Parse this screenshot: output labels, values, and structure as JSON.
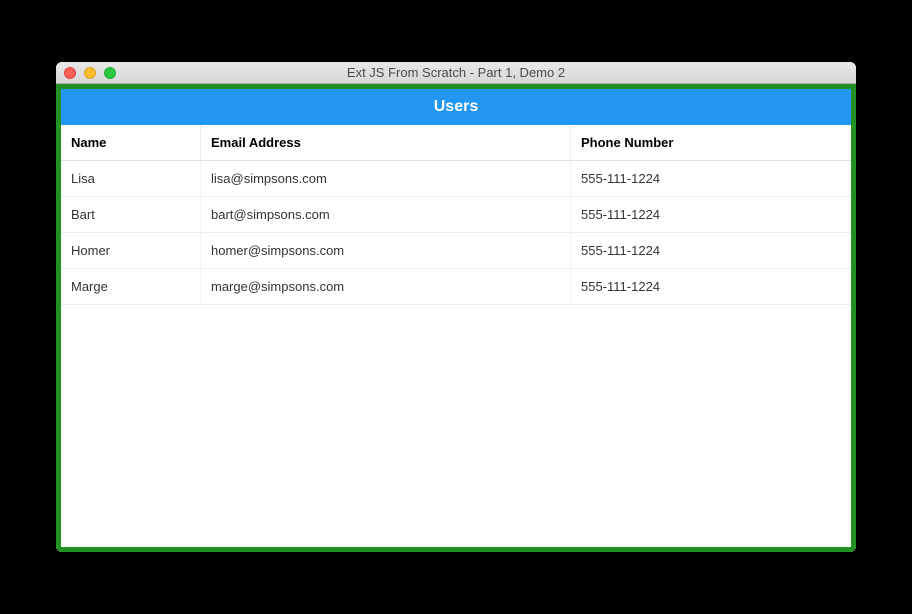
{
  "window": {
    "title": "Ext JS From Scratch - Part 1, Demo 2"
  },
  "panel": {
    "title": "Users"
  },
  "grid": {
    "columns": [
      {
        "label": "Name"
      },
      {
        "label": "Email Address"
      },
      {
        "label": "Phone Number"
      }
    ],
    "rows": [
      {
        "name": "Lisa",
        "email": "lisa@simpsons.com",
        "phone": "555-111-1224"
      },
      {
        "name": "Bart",
        "email": "bart@simpsons.com",
        "phone": "555-111-1224"
      },
      {
        "name": "Homer",
        "email": "homer@simpsons.com",
        "phone": "555-111-1224"
      },
      {
        "name": "Marge",
        "email": "marge@simpsons.com",
        "phone": "555-111-1224"
      }
    ]
  }
}
